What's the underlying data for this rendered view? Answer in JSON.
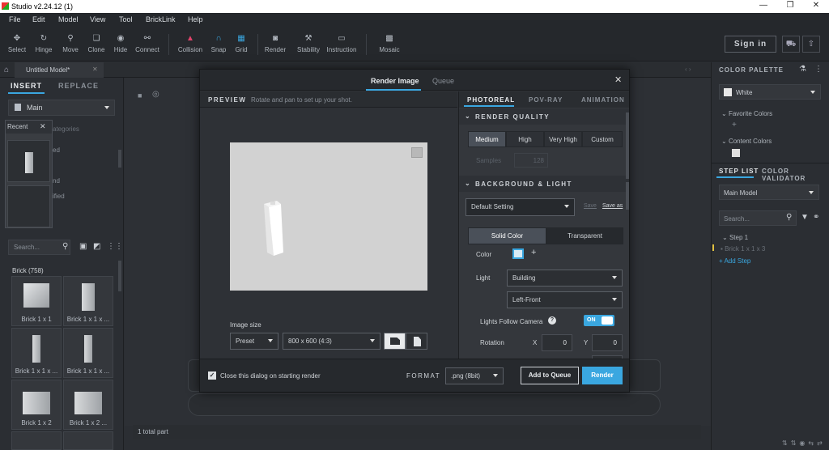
{
  "window": {
    "title": "Studio v2.24.12 (1)",
    "min_glyph": "—",
    "max_glyph": "❐",
    "close_glyph": "✕"
  },
  "menu": [
    "File",
    "Edit",
    "Model",
    "View",
    "Tool",
    "BrickLink",
    "Help"
  ],
  "toolbar": {
    "tools": [
      {
        "label": "Select",
        "icon": "pointer-icon"
      },
      {
        "label": "Hinge",
        "icon": "hinge-icon"
      },
      {
        "label": "Move",
        "icon": "move-icon"
      },
      {
        "label": "Clone",
        "icon": "clone-icon"
      },
      {
        "label": "Hide",
        "icon": "hide-icon"
      },
      {
        "label": "Connect",
        "icon": "connect-icon"
      },
      {
        "label": "Collision",
        "icon": "collision-icon"
      },
      {
        "label": "Snap",
        "icon": "snap-icon"
      },
      {
        "label": "Grid",
        "icon": "grid-icon"
      },
      {
        "label": "Render",
        "icon": "camera-icon"
      },
      {
        "label": "Stability",
        "icon": "stability-icon"
      },
      {
        "label": "Instruction",
        "icon": "instruction-icon"
      },
      {
        "label": "Mosaic",
        "icon": "mosaic-icon"
      }
    ],
    "sign_in": "Sign in"
  },
  "doc_tab": {
    "label": "Untitled Model*"
  },
  "left_panel": {
    "insert_tab": "INSERT",
    "replace_tab": "REPLACE",
    "palette": "Main",
    "recent_label": "Recent",
    "partial_texts": [
      "ategories",
      "ed",
      "nd",
      "ified"
    ],
    "search_placeholder": "Search...",
    "category": "Brick (758)",
    "bricks": [
      {
        "label": "Brick 1 x 1"
      },
      {
        "label": "Brick 1 x 1 x ..."
      },
      {
        "label": "Brick 1 x 1 x ..."
      },
      {
        "label": "Brick 1 x 1 x ..."
      },
      {
        "label": "Brick 1 x 2"
      },
      {
        "label": "Brick 1 x 2 ..."
      }
    ]
  },
  "status": {
    "parts": "1 total part"
  },
  "right_panel": {
    "color_palette": "COLOR PALETTE",
    "color": "White",
    "favorite_colors": "Favorite Colors",
    "content_colors": "Content Colors",
    "step_list_tab": "STEP LIST",
    "color_validator_tab": "COLOR VALIDATOR",
    "model_select": "Main Model",
    "search_placeholder": "Search...",
    "step": "Step 1",
    "step_item": "Brick 1 x 1 x 3",
    "add_step": "+ Add Step"
  },
  "dialog": {
    "tab_render": "Render Image",
    "tab_queue": "Queue",
    "preview_label": "PREVIEW",
    "preview_hint": "Rotate and pan to set up your shot.",
    "image_size_label": "Image size",
    "size_mode": "Preset",
    "size_value": "800 x 600 (4:3)",
    "render_tabs": [
      "PHOTOREAL",
      "POV-RAY",
      "ANIMATION"
    ],
    "render_quality_label": "RENDER QUALITY",
    "quality_options": [
      "Medium",
      "High",
      "Very High",
      "Custom"
    ],
    "samples_label": "Samples",
    "samples_value": "128",
    "bg_light_label": "BACKGROUND & LIGHT",
    "bg_setting": "Default Setting",
    "save_label": "Save",
    "save_as_label": "Save as",
    "bg_modes": [
      "Solid Color",
      "Transparent"
    ],
    "color_label": "Color",
    "light_label": "Light",
    "light_value": "Building",
    "light_direction": "Left-Front",
    "lights_follow_label": "Lights Follow Camera",
    "toggle_on": "ON",
    "rotation_label": "Rotation",
    "rot_x_label": "X",
    "rot_x": "0",
    "rot_y_label": "Y",
    "rot_y": "0",
    "close_dialog_label": "Close this dialog on starting render",
    "format_label": "FORMAT",
    "format_value": ".png (8bit)",
    "add_queue": "Add to Queue",
    "render_btn": "Render",
    "accent": "#3aa7e0"
  }
}
